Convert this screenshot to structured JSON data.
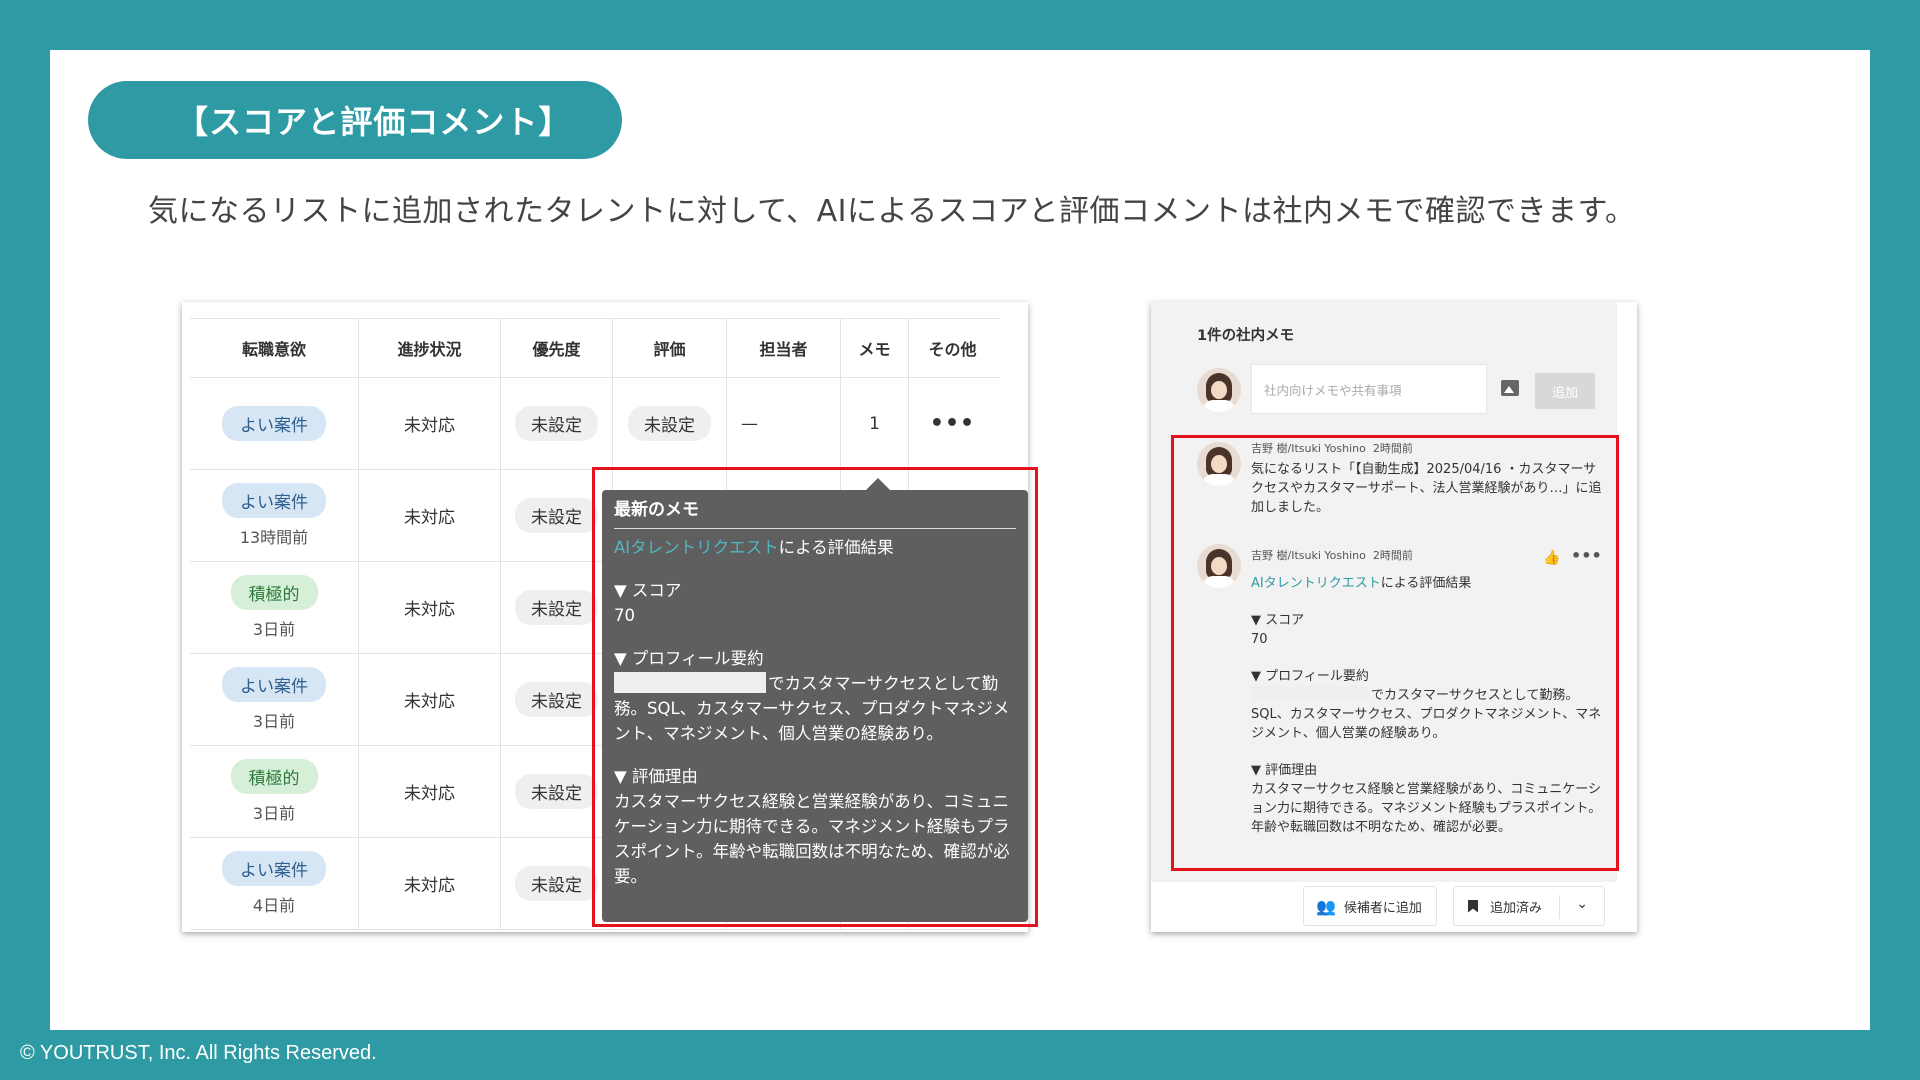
{
  "slide": {
    "title": "【スコアと評価コメント】",
    "subtitle": "気になるリストに追加されたタレントに対して、AIによるスコアと評価コメントは社内メモで確認できます。",
    "copyright": "© YOUTRUST, Inc. All Rights Reserved."
  },
  "table": {
    "headers": [
      "転職意欲",
      "進捗状況",
      "優先度",
      "評価",
      "担当者",
      "メモ",
      "その他"
    ],
    "rows": [
      {
        "badge": "よい案件",
        "time": "",
        "status": "未対応",
        "priority": "未設定",
        "eval": "未設定",
        "assignee": "—",
        "memo": "1",
        "more": "•••"
      },
      {
        "badge": "よい案件",
        "time": "13時間前",
        "status": "未対応",
        "priority": "未設定",
        "eval": "",
        "assignee": "",
        "memo": "",
        "more": ""
      },
      {
        "badge": "積極的",
        "time": "3日前",
        "status": "未対応",
        "priority": "未設定",
        "eval": "",
        "assignee": "",
        "memo": "",
        "more": ""
      },
      {
        "badge": "よい案件",
        "time": "3日前",
        "status": "未対応",
        "priority": "未設定",
        "eval": "",
        "assignee": "",
        "memo": "",
        "more": ""
      },
      {
        "badge": "積極的",
        "time": "3日前",
        "status": "未対応",
        "priority": "未設定",
        "eval": "",
        "assignee": "",
        "memo": "",
        "more": ""
      },
      {
        "badge": "よい案件",
        "time": "4日前",
        "status": "未対応",
        "priority": "未設定",
        "eval": "",
        "assignee": "",
        "memo": "",
        "more": ""
      }
    ]
  },
  "popup": {
    "title": "最新のメモ",
    "link": "AIタレントリクエスト",
    "result_suffix": "による評価結果",
    "score_label": "▼ スコア",
    "score": "70",
    "profile_label": "▼ プロフィール要約",
    "profile_text": "でカスタマーサクセスとして勤務。SQL、カスタマーサクセス、プロダクトマネジメント、マネジメント、個人営業の経験あり。",
    "reason_label": "▼ 評価理由",
    "reason_text": "カスタマーサクセス経験と営業経験があり、コミュニケーション力に期待できる。マネジメント経験もプラスポイント。年齢や転職回数は不明なため、確認が必要。"
  },
  "memo": {
    "count_title": "1件の社内メモ",
    "input_placeholder": "社内向けメモや共有事項",
    "add_button": "追加",
    "entries": [
      {
        "author": "吉野 樹/Itsuki Yoshino",
        "time": "2時間前",
        "text": "気になるリスト「【自動生成】2025/04/16 ・カスタマーサクセスやカスタマーサポート、法人営業経験があり…」に追加しました。"
      },
      {
        "author": "吉野 樹/Itsuki Yoshino",
        "time": "2時間前",
        "link": "AIタレントリクエスト",
        "result_suffix": "による評価結果",
        "score_label": "▼ スコア",
        "score": "70",
        "profile_label": "▼ プロフィール要約",
        "profile_text": "でカスタマーサクセスとして勤務。SQL、カスタマーサクセス、プロダクトマネジメント、マネジメント、個人営業の経験あり。",
        "reason_label": "▼ 評価理由",
        "reason_text": "カスタマーサクセス経験と営業経験があり、コミュニケーション力に期待できる。マネジメント経験もプラスポイント。年齢や転職回数は不明なため、確認が必要。"
      }
    ],
    "candidate_button": "候補者に追加",
    "added_button": "追加済み"
  },
  "icons": [
    "people-add-icon",
    "bookmark-icon",
    "chevron-down-icon",
    "image-icon",
    "thumbs-up-icon",
    "more-icon"
  ],
  "colors": {
    "teal": "#2e9aa4",
    "highlight": "#e5111b",
    "popup_bg": "#5f5f5f"
  }
}
